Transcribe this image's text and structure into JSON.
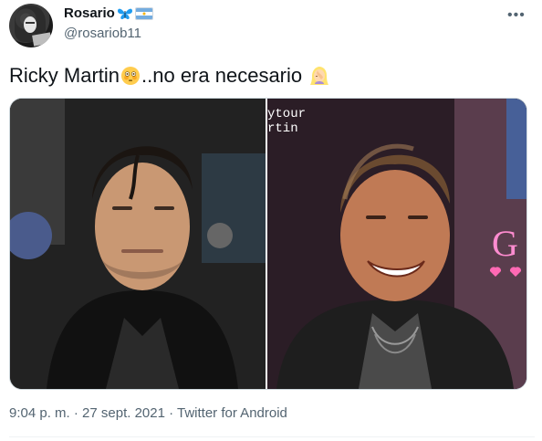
{
  "tweet": {
    "display_name": "Rosario",
    "handle": "@rosariob11",
    "more_label": "•••",
    "text_part1": "Ricky Martin",
    "text_part2": "..no era necesario",
    "emoji_1": "flushed-face-icon",
    "emoji_2": "woman-facepalming-icon",
    "photo_right_overlay_line1": "ytour",
    "photo_right_overlay_line2": "rtin",
    "photo_right_letter": "G",
    "timestamp": "9:04 p. m. · 27 sept. 2021 · Twitter for Android"
  },
  "colors": {
    "text": "#0f1419",
    "secondary": "#536471",
    "border": "#cfd9de",
    "flag_blue": "#74acdf",
    "flag_sun": "#f6b40e",
    "pink": "#ff69b4",
    "butterfly": "#1d9bf0"
  }
}
